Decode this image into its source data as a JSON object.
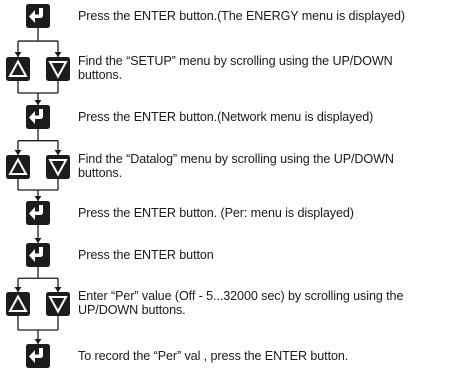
{
  "steps": [
    {
      "buttons": [
        "enter"
      ],
      "text": "Press the ENTER button.(The ENERGY menu is displayed)"
    },
    {
      "buttons": [
        "up",
        "down"
      ],
      "text": "Find the “SETUP” menu by scrolling using the UP/DOWN\nbuttons."
    },
    {
      "buttons": [
        "enter"
      ],
      "text": "Press the ENTER button.(Network menu is displayed)"
    },
    {
      "buttons": [
        "up",
        "down"
      ],
      "text": "Find the “Datalog” menu by scrolling using the UP/DOWN\nbuttons."
    },
    {
      "buttons": [
        "enter"
      ],
      "text": "Press the ENTER button. (Per: menu is displayed)"
    },
    {
      "buttons": [
        "enter"
      ],
      "text": "Press the ENTER button"
    },
    {
      "buttons": [
        "up",
        "down"
      ],
      "text": "Enter “Per”  value (Off - 5...32000 sec) by scrolling using the\nUP/DOWN buttons."
    },
    {
      "buttons": [
        "enter"
      ],
      "text": "To record the “Per” val , press the ENTER button."
    }
  ],
  "colors": {
    "button_fill": "#1c1c1c",
    "line": "#1c1c1c",
    "text": "#1a1a1a"
  },
  "icons": {
    "enter": "enter-arrow-icon",
    "up": "up-arrow-icon",
    "down": "down-arrow-icon"
  }
}
